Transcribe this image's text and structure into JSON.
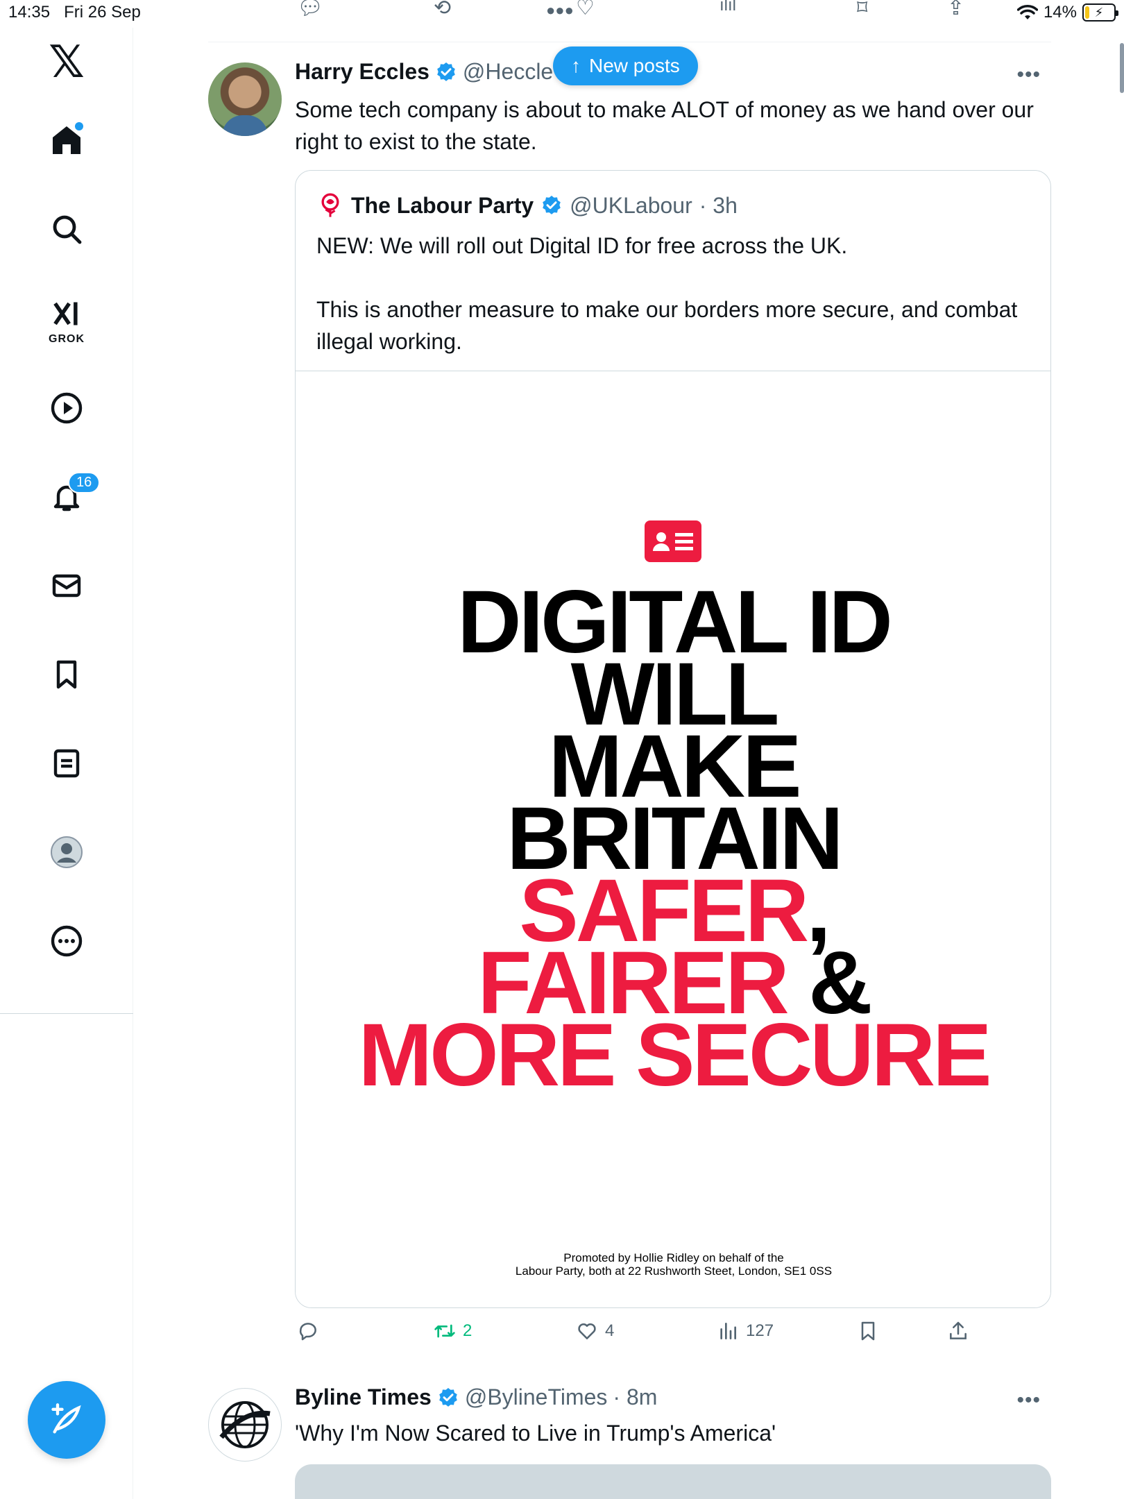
{
  "status_bar": {
    "time": "14:35",
    "date": "Fri 26 Sep",
    "battery": "14%"
  },
  "sidebar": {
    "logo": "𝕏",
    "grok_label": "GROK",
    "notifications_count": "16"
  },
  "new_posts": {
    "label": "New posts"
  },
  "tweet": {
    "author_name": "Harry Eccles",
    "author_handle": "@Heccle",
    "text": "Some tech company is about to make ALOT of money as we hand over our right to exist to the state.",
    "quote": {
      "author_name": "The Labour Party",
      "author_handle": "@UKLabour",
      "time": "· 3h",
      "paragraph_1": "NEW: We will roll out Digital ID for free across the UK.",
      "paragraph_2": "This is another measure to make our borders more secure, and combat illegal working.",
      "poster": {
        "line1": "DIGITAL ID",
        "line2": "WILL",
        "line3": "MAKE",
        "line4": "BRITAIN",
        "line5": "SAFER",
        "line5_suffix": ",",
        "line6": "FAIRER",
        "line6_suffix": " &",
        "line7": "MORE SECURE",
        "promo_line1": "Promoted by Hollie Ridley on behalf of the",
        "promo_line2": "Labour Party, both at 22 Rushworth Steet, London, SE1 0SS"
      }
    },
    "actions": {
      "retweets": "2",
      "likes": "4",
      "views": "127"
    }
  },
  "tweet2": {
    "author_name": "Byline Times",
    "author_handle": "@BylineTimes",
    "time": "· 8m",
    "text": "'Why I'm Now Scared to Live in Trump's America'"
  },
  "colors": {
    "accent": "#1d9bf0",
    "labour_red": "#ed1c40",
    "retweet_green": "#00ba7c",
    "muted": "#536471"
  }
}
